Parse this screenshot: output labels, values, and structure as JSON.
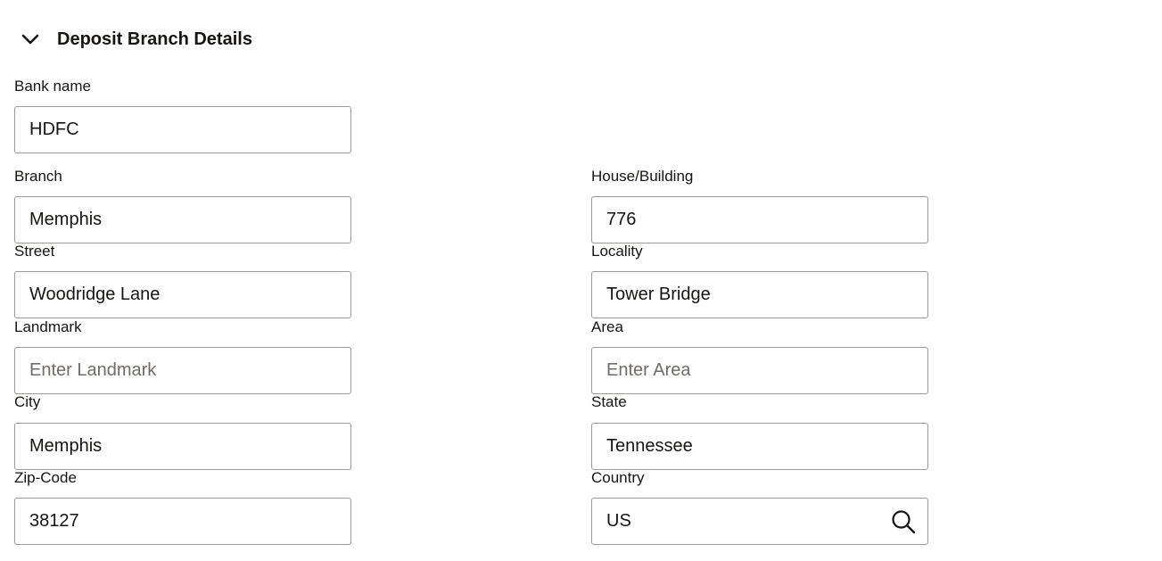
{
  "section": {
    "title": "Deposit Branch Details"
  },
  "fields": {
    "bank_name": {
      "label": "Bank name",
      "value": "HDFC",
      "placeholder": ""
    },
    "branch": {
      "label": "Branch",
      "value": "Memphis",
      "placeholder": ""
    },
    "house_building": {
      "label": "House/Building",
      "value": "776",
      "placeholder": ""
    },
    "street": {
      "label": "Street",
      "value": "Woodridge Lane",
      "placeholder": ""
    },
    "locality": {
      "label": "Locality",
      "value": "Tower Bridge",
      "placeholder": ""
    },
    "landmark": {
      "label": "Landmark",
      "value": "",
      "placeholder": "Enter Landmark"
    },
    "area": {
      "label": "Area",
      "value": "",
      "placeholder": "Enter Area"
    },
    "city": {
      "label": "City",
      "value": "Memphis",
      "placeholder": ""
    },
    "state": {
      "label": "State",
      "value": "Tennessee",
      "placeholder": ""
    },
    "zip_code": {
      "label": "Zip-Code",
      "value": "38127",
      "placeholder": ""
    },
    "country": {
      "label": "Country",
      "value": "US",
      "placeholder": ""
    }
  },
  "icons": {
    "collapse": "chevron-down-icon",
    "country_lookup": "search-icon"
  },
  "colors": {
    "text": "#161513",
    "border": "#9e9a96",
    "placeholder": "#6f6c69"
  }
}
